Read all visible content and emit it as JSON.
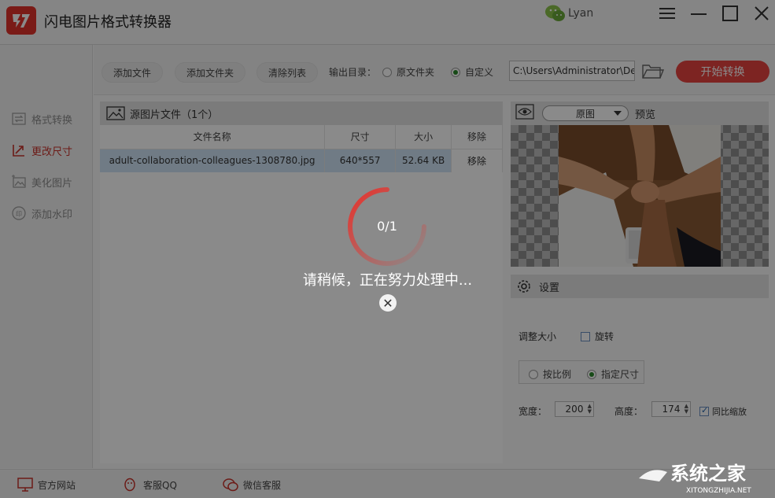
{
  "app": {
    "title": "闪电图片格式转换器",
    "user": "Lyan"
  },
  "sidebar": {
    "items": [
      {
        "label": "格式转换",
        "active": false
      },
      {
        "label": "更改尺寸",
        "active": true
      },
      {
        "label": "美化图片",
        "active": false
      },
      {
        "label": "添加水印",
        "active": false
      }
    ]
  },
  "toolbar": {
    "add_file": "添加文件",
    "add_folder": "添加文件夹",
    "clear_list": "清除列表",
    "output_label": "输出目录：",
    "opt_source": "原文件夹",
    "opt_custom": "自定义",
    "selected_output": "自定义",
    "output_path": "C:\\Users\\Administrator\\De",
    "start": "开始转换"
  },
  "files": {
    "header": "源图片文件（1个）",
    "columns": [
      "文件名称",
      "尺寸",
      "大小",
      "移除"
    ],
    "rows": [
      {
        "name": "adult-collaboration-colleagues-1308780.jpg",
        "dimensions": "640*557",
        "size": "52.64 KB",
        "action": "移除"
      }
    ]
  },
  "preview": {
    "mode": "原图",
    "label": "预览"
  },
  "settings": {
    "title": "设置",
    "resize_label": "调整大小",
    "rotate_label": "旋转",
    "rotate_checked": false,
    "by_ratio": "按比例",
    "by_size": "指定尺寸",
    "selected_mode": "指定尺寸",
    "width_label": "宽度：",
    "width_value": "200",
    "height_label": "高度：",
    "height_value": "174",
    "keep_ratio_label": "同比缩放",
    "keep_ratio_checked": true
  },
  "footer": {
    "website": "官方网站",
    "qq": "客服QQ",
    "wechat": "微信客服"
  },
  "overlay": {
    "progress": "0/1",
    "message": "请稍候，正在努力处理中...",
    "progress_fraction": 0.0
  },
  "watermark": {
    "text": "系统之家",
    "url": "XITONGZHIJIA.NET"
  },
  "colors": {
    "accent": "#e84340",
    "brand": "#e2332b",
    "selected_row": "#cfe3f5"
  }
}
